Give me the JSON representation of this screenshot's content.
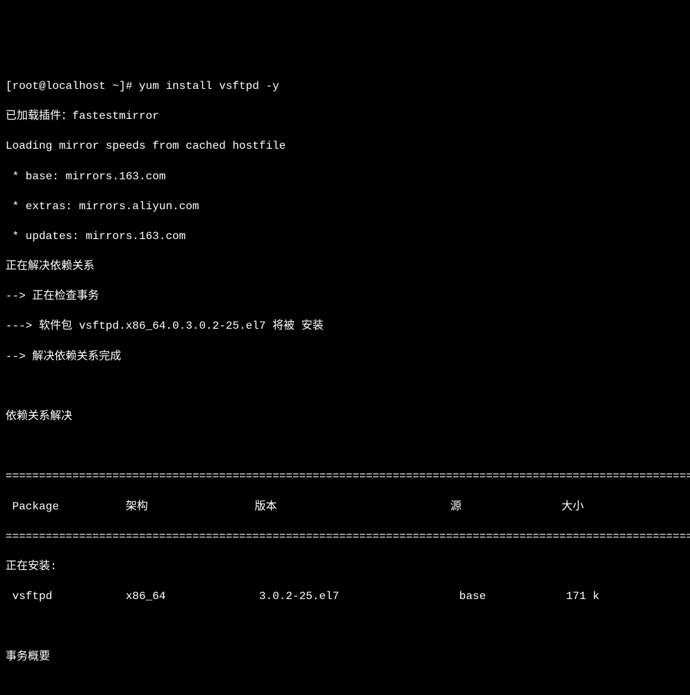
{
  "prompt": "[root@localhost ~]# ",
  "command": "yum install vsftpd -y",
  "lines": {
    "plugins_loaded": "已加载插件：fastestmirror",
    "loading_mirrors": "Loading mirror speeds from cached hostfile",
    "mirror_base": " * base: mirrors.163.com",
    "mirror_extras": " * extras: mirrors.aliyun.com",
    "mirror_updates": " * updates: mirrors.163.com",
    "resolving_deps": "正在解决依赖关系",
    "checking_trans": "--> 正在检查事务",
    "package_info": "---> 软件包 vsftpd.x86_64.0.3.0.2-25.el7 将被 安装",
    "finished_deps": "--> 解决依赖关系完成",
    "deps_resolved": "依赖关系解决"
  },
  "divider": "============================================================================================================",
  "table_header": " Package          架构                版本                          源               大小",
  "installing_label": "正在安装:",
  "table_row": " vsftpd           x86_64              3.0.2-25.el7                  base            171 k",
  "transaction_summary": "事务概要"
}
